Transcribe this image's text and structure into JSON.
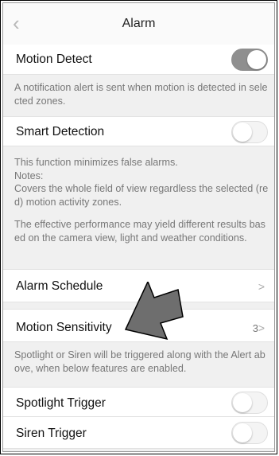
{
  "header": {
    "title": "Alarm",
    "back_icon": "chevron-left-icon"
  },
  "motion_detect": {
    "label": "Motion Detect",
    "enabled": true,
    "description": "A notification alert is sent when motion is detected in selected zones."
  },
  "smart_detection": {
    "label": "Smart Detection",
    "enabled": false,
    "desc_line1": "This function minimizes false alarms.",
    "desc_line2": "Notes:",
    "desc_line3": "Covers the whole field of view regardless the selected (red) motion activity zones.",
    "desc_line4": "The effective performance may yield different results based on the camera view, light and weather conditions."
  },
  "alarm_schedule": {
    "label": "Alarm Schedule",
    "chevron": ">"
  },
  "motion_sensitivity": {
    "label": "Motion Sensitivity",
    "value": "3",
    "chevron": ">"
  },
  "trigger_note": "Spotlight or Siren will be triggered along with the Alert above, when below features are enabled.",
  "spotlight_trigger": {
    "label": "Spotlight Trigger",
    "enabled": false
  },
  "siren_trigger": {
    "label": "Siren Trigger",
    "enabled": false
  },
  "annotation": {
    "icon": "pointer-arrow-icon",
    "color": "#6e6e6e"
  }
}
